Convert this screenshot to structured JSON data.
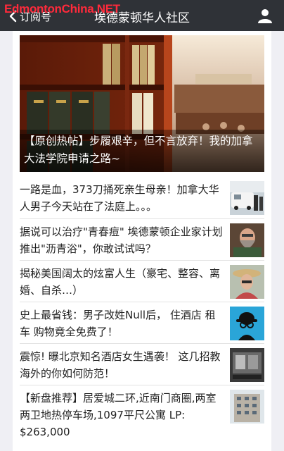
{
  "watermark": "EdmontonChina.NET",
  "nav": {
    "back_label": "订阅号",
    "title": "埃德蒙顿华人社区"
  },
  "hero": {
    "caption": "【原创热帖】步履艰辛，但不言放弃！我的加拿大法学院申请之路~"
  },
  "articles": [
    {
      "title": "一路是血，373刀捅死亲生母亲！加拿大华人男子今天站在了法庭上。。。",
      "thumb": "courthouse-van-photo"
    },
    {
      "title": "据说可以治疗\"青春痘\" 埃德蒙顿企业家计划推出\"沥青浴\"，你敢试试吗？",
      "thumb": "bearded-man-photo"
    },
    {
      "title": "揭秘美国阔太的炫富人生（豪宅、整容、离婚、自杀…）",
      "thumb": "woman-hat-photo"
    },
    {
      "title": "史上最省钱：男子改姓Null后， 住酒店 租车 购物竟全免费了！",
      "thumb": "bowler-hat-icon"
    },
    {
      "title": "震惊! 曝北京知名酒店女生遇袭！ 这几招教海外的你如何防范！",
      "thumb": "hotel-corridor-photo"
    },
    {
      "title": "【新盘推荐】居爱城二环,近南门商圈,两室两卫地热停车场,1097平尺公寓 LP: $263,000",
      "thumb": "apartment-building-photo"
    }
  ],
  "colors": {
    "navbar": "#2f3237",
    "watermark": "#ff2a3b",
    "background": "#efeff4"
  }
}
